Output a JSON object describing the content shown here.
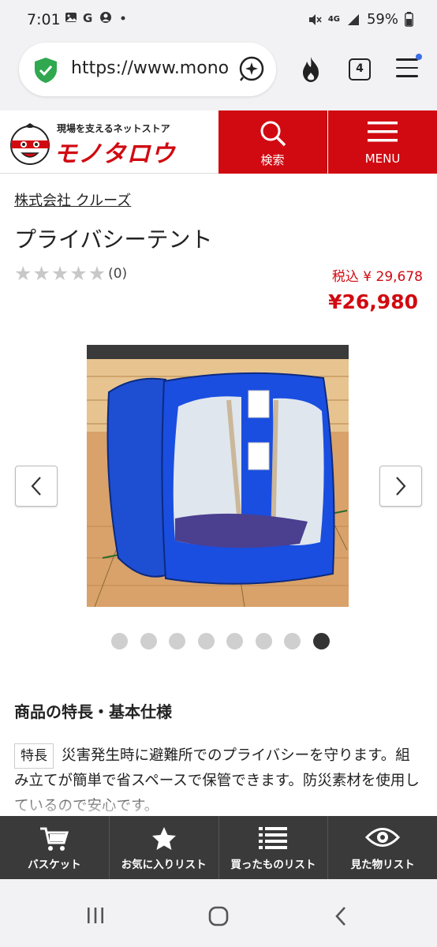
{
  "status_bar": {
    "time": "7:01",
    "left_icons": [
      "image-icon",
      "google-icon",
      "account-icon",
      "dot-icon"
    ],
    "network": "4G",
    "battery": "59%"
  },
  "browser": {
    "url": "https://www.monotaro.com",
    "tab_count": "4"
  },
  "site_header": {
    "tagline": "現場を支えるネットストア",
    "logo_text": "モノタロウ",
    "search_label": "検索",
    "menu_label": "MENU",
    "brand_color": "#d10a11"
  },
  "product": {
    "maker": "株式会社 クルーズ",
    "title": "プライバシーテント",
    "review_count": "(0)",
    "stars_filled": 0,
    "stars_total": 5,
    "price_tax_label": "税込 ¥ 29,678",
    "price": "¥26,980"
  },
  "gallery": {
    "image_count": 8,
    "active_index": 8
  },
  "features": {
    "heading": "商品の特長・基本仕様",
    "tag": "特長",
    "text": "災害発生時に避難所でのプライバシーを守ります。組み立てが簡単で省スペースで保管できます。防災素材を使用しているので安心です。"
  },
  "bottom_nav": {
    "items": [
      {
        "label": "バスケット",
        "icon": "cart-icon"
      },
      {
        "label": "お気に入りリスト",
        "icon": "star-icon"
      },
      {
        "label": "買ったものリスト",
        "icon": "list-icon"
      },
      {
        "label": "見た物リスト",
        "icon": "eye-icon"
      }
    ]
  }
}
